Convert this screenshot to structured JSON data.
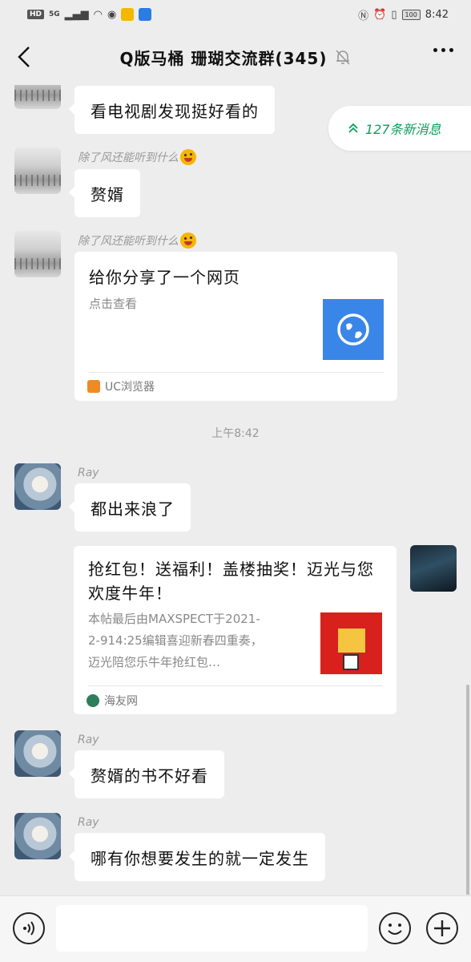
{
  "status_bar": {
    "hd": "HD",
    "network": "5G",
    "battery": "100",
    "time": "8:42"
  },
  "header": {
    "title": "Q版马桶 珊瑚交流群(345)"
  },
  "new_messages": "127条新消息",
  "messages": [
    {
      "text": "看电视剧发现挺好看的"
    },
    {
      "sender": "除了风还能听到什么",
      "text": "赘婿"
    },
    {
      "sender": "除了风还能听到什么",
      "card": {
        "title": "给你分享了一个网页",
        "desc": "点击查看",
        "source": "UC浏览器"
      }
    },
    {
      "timestamp": "上午8:42"
    },
    {
      "sender": "Ray",
      "text": "都出来浪了"
    },
    {
      "card": {
        "title": "抢红包！送福利！盖楼抽奖！迈光与您欢度牛年！",
        "desc": "本帖最后由MAXSPECT于2021-2-914:25编辑喜迎新春四重奏，迈光陪您乐牛年抢红包…",
        "source": "海友网"
      }
    },
    {
      "sender": "Ray",
      "text": "赘婿的书不好看"
    },
    {
      "sender": "Ray",
      "text": "哪有你想要发生的就一定发生"
    }
  ],
  "input": {
    "value": ""
  },
  "colors": {
    "accent_green": "#07a05a",
    "link_blue": "#3a86e8",
    "background": "#ededed"
  }
}
